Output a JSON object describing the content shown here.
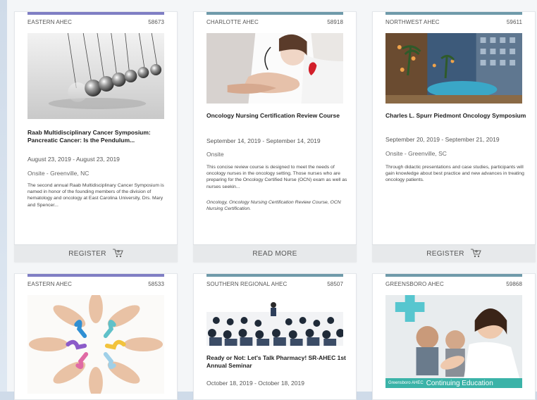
{
  "cards": [
    {
      "org": "EASTERN AHEC",
      "id": "58673",
      "bar_color": "#7f7ec4",
      "image": "newtons-cradle-image",
      "title": "Raab Multidisciplinary Cancer Symposium: Pancreatic Cancer: Is the Pendulum...",
      "date": "August 23, 2019 - August 23, 2019",
      "location": "Onsite - Greenville, NC",
      "description": "The second annual Raab Multidisciplinary Cancer Symposium is named in honor of the founding members of the division of hematology and oncology at East Carolina University, Drs. Mary and Spencer...",
      "tags": "",
      "action": "REGISTER",
      "action_icon": "cart-icon"
    },
    {
      "org": "CHARLOTTE AHEC",
      "id": "58918",
      "bar_color": "#6f9aaa",
      "image": "nurse-holding-hands-image",
      "title": "Oncology Nursing Certification Review Course",
      "date": "September 14, 2019 - September 14, 2019",
      "location": "Onsite",
      "description": "This concise review course is designed to meet the needs of oncology nurses in the oncology setting. Those nurses who are preparing for the Oncology Certified Nurse (OCN) exam as well as nurses seekin...",
      "tags": "Oncology, Oncology Nursing Certification Review Course, OCN Nursing Certification.",
      "action": "READ MORE",
      "action_icon": ""
    },
    {
      "org": "NORTHWEST AHEC",
      "id": "59611",
      "bar_color": "#6f9aaa",
      "image": "hotel-atrium-image",
      "title": "Charles L. Spurr Piedmont Oncology Symposium",
      "date": "September 20, 2019 - September 21, 2019",
      "location": "Onsite - Greenville, SC",
      "description": "Through didactic presentations and case studies, participants will gain knowledge about best practice and new advances in treating oncology patients.",
      "tags": "",
      "action": "REGISTER",
      "action_icon": "cart-icon"
    },
    {
      "org": "EASTERN AHEC",
      "id": "58533",
      "bar_color": "#7f7ec4",
      "image": "awareness-ribbons-hands-image",
      "title": "",
      "date": "",
      "location": "",
      "description": "",
      "tags": "",
      "action": "",
      "action_icon": ""
    },
    {
      "org": "SOUTHERN REGIONAL AHEC",
      "id": "58507",
      "bar_color": "#6f9aaa",
      "image": "seminar-audience-image",
      "title": "Ready or Not: Let's Talk Pharmacy! SR-AHEC 1st Annual Seminar",
      "date": "October 18, 2019 - October 18, 2019",
      "location": "",
      "description": "",
      "tags": "",
      "action": "",
      "action_icon": ""
    },
    {
      "org": "GREENSBORO AHEC",
      "id": "59868",
      "bar_color": "#6f9aaa",
      "image": "continuing-education-image",
      "image_caption_small": "Greensboro AHEC",
      "image_caption": "Continuing Education",
      "title": "",
      "date": "",
      "location": "",
      "description": "",
      "tags": "",
      "action": "",
      "action_icon": ""
    }
  ]
}
